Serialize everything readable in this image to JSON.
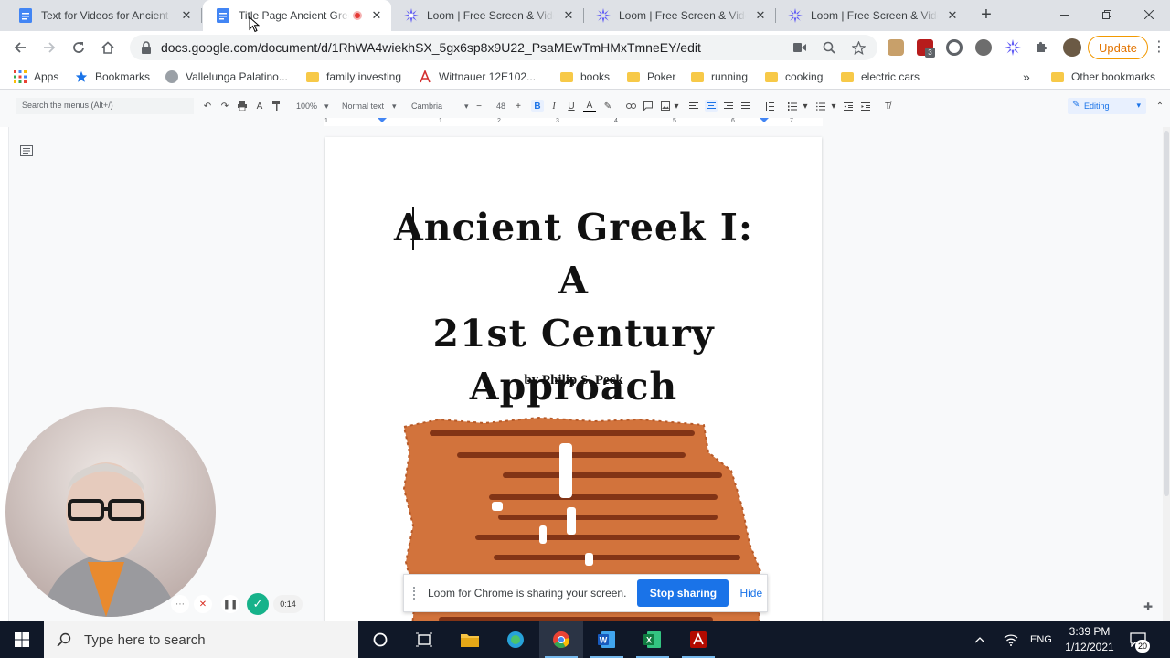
{
  "tabs": [
    {
      "title": "Text for Videos for Ancient Greek",
      "icon": "google-docs-icon",
      "active": false
    },
    {
      "title": "Title Page Ancient Greek",
      "icon": "google-docs-icon",
      "active": true,
      "recording": true
    },
    {
      "title": "Loom | Free Screen & Video Recording",
      "icon": "loom-icon",
      "active": false
    },
    {
      "title": "Loom | Free Screen & Video Recording",
      "icon": "loom-icon",
      "active": false
    },
    {
      "title": "Loom | Free Screen & Video Recording",
      "icon": "loom-icon",
      "active": false
    }
  ],
  "toolbar": {
    "url": "docs.google.com/document/d/1RhWA4wiekhSX_5gx6sp8x9U22_PsaMEwTmHMxTmneEY/edit",
    "update_label": "Update",
    "extension_badge": "3"
  },
  "bookmarks": [
    {
      "label": "Apps",
      "icon": "apps-grid-icon"
    },
    {
      "label": "Bookmarks",
      "icon": "star-icon"
    },
    {
      "label": "Vallelunga Palatino...",
      "icon": "site-icon"
    },
    {
      "label": "family investing",
      "icon": "folder-icon"
    },
    {
      "label": "Wittnauer 12E102...",
      "icon": "acrobat-icon"
    },
    {
      "label": "books",
      "icon": "folder-icon"
    },
    {
      "label": "Poker",
      "icon": "folder-icon"
    },
    {
      "label": "running",
      "icon": "folder-icon"
    },
    {
      "label": "cooking",
      "icon": "folder-icon"
    },
    {
      "label": "electric cars",
      "icon": "folder-icon"
    }
  ],
  "bookmarks_overflow": "»",
  "other_bookmarks": "Other bookmarks",
  "docs_toolbar": {
    "menu_search": "Search the menus (Alt+/)",
    "zoom": "100%",
    "style": "Normal text",
    "font": "Cambria",
    "font_size": "48",
    "mode": "Editing"
  },
  "ruler_numbers": [
    "1",
    "1",
    "2",
    "3",
    "4",
    "5",
    "6",
    "7"
  ],
  "document": {
    "title_lines": [
      "Ancient Greek I: A",
      "21st Century",
      "Approach"
    ],
    "byline": "by Philip S. Peck"
  },
  "loom": {
    "share_message": "Loom for Chrome is sharing your screen.",
    "stop_label": "Stop sharing",
    "hide_label": "Hide",
    "timer": "0:14"
  },
  "taskbar": {
    "search_placeholder": "Type here to search",
    "language": "ENG",
    "time": "3:39 PM",
    "date": "1/12/2021",
    "notification_count": "20"
  },
  "colors": {
    "accent": "#1a73e8",
    "update": "#e37400",
    "taskbar": "#101828",
    "recording": "#e53935"
  }
}
